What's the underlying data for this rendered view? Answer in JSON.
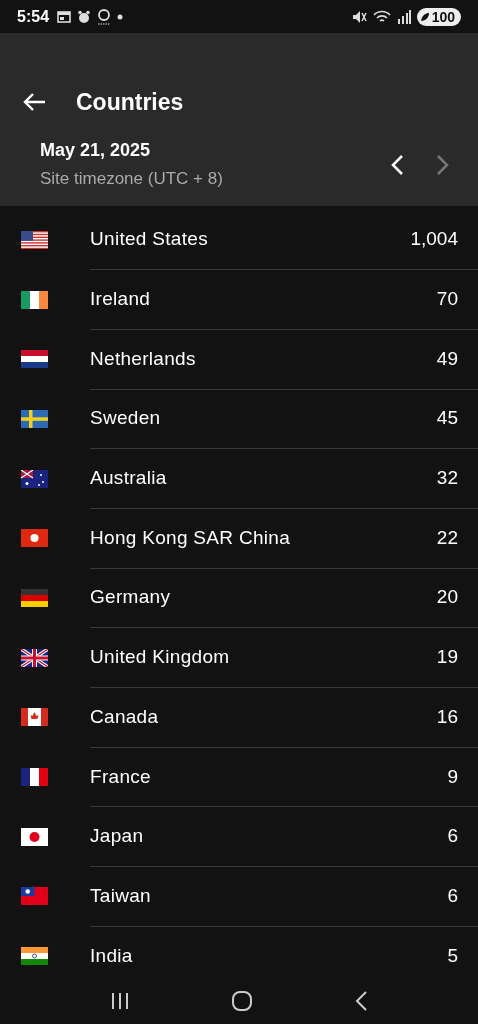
{
  "status_bar": {
    "time": "5:54",
    "battery": "100"
  },
  "app_bar": {
    "title": "Countries"
  },
  "date_header": {
    "date": "May 21, 2025",
    "timezone": "Site timezone (UTC + 8)",
    "previous": {
      "disabled": false
    },
    "next": {
      "disabled": true
    }
  },
  "countries": [
    {
      "name": "United States",
      "count": "1,004"
    },
    {
      "name": "Ireland",
      "count": "70"
    },
    {
      "name": "Netherlands",
      "count": "49"
    },
    {
      "name": "Sweden",
      "count": "45"
    },
    {
      "name": "Australia",
      "count": "32"
    },
    {
      "name": "Hong Kong SAR China",
      "count": "22"
    },
    {
      "name": "Germany",
      "count": "20"
    },
    {
      "name": "United Kingdom",
      "count": "19"
    },
    {
      "name": "Canada",
      "count": "16"
    },
    {
      "name": "France",
      "count": "9"
    },
    {
      "name": "Japan",
      "count": "6"
    },
    {
      "name": "Taiwan",
      "count": "6"
    },
    {
      "name": "India",
      "count": "5"
    }
  ]
}
